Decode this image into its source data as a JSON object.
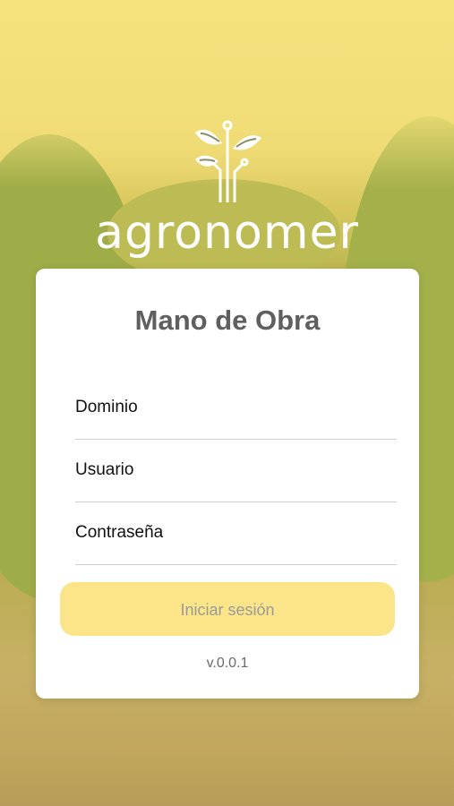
{
  "brand": {
    "logo_text": "agronomer",
    "logo_icon": "plant-circuit-icon"
  },
  "login": {
    "title": "Mano de Obra",
    "fields": {
      "domain_placeholder": "Dominio",
      "user_placeholder": "Usuario",
      "password_placeholder": "Contraseña"
    },
    "submit_label": "Iniciar sesión",
    "version": "v.0.0.1"
  },
  "colors": {
    "button_bg": "#fce589",
    "button_text": "#9a9a9a",
    "title_text": "#5f5f5f",
    "card_bg": "#ffffff"
  }
}
